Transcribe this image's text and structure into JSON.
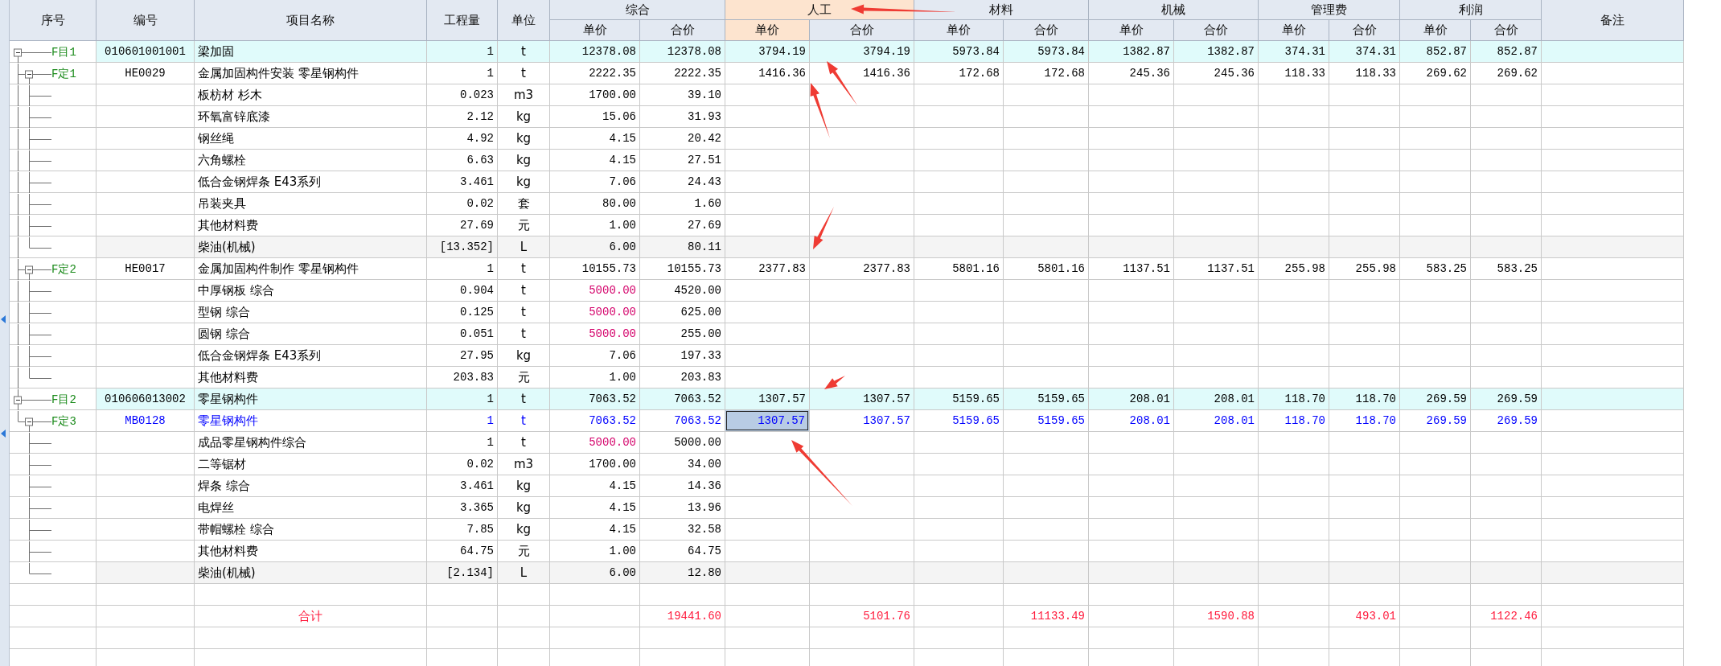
{
  "table": {
    "columns": [
      {
        "label": "序号"
      },
      {
        "label": "编号"
      },
      {
        "label": "项目名称"
      },
      {
        "label": "工程量"
      },
      {
        "label": "单位"
      },
      {
        "label": "综合",
        "subcolumns": [
          {
            "label": "单价",
            "selected": false
          },
          {
            "label": "合价",
            "selected": false
          }
        ]
      },
      {
        "label": "人工",
        "subcolumns": [
          {
            "label": "单价",
            "selected": true
          },
          {
            "label": "合价",
            "selected": false
          }
        ]
      },
      {
        "label": "材料",
        "subcolumns": [
          {
            "label": "单价",
            "selected": false
          },
          {
            "label": "合价",
            "selected": false
          }
        ]
      },
      {
        "label": "机械",
        "subcolumns": [
          {
            "label": "单价",
            "selected": false
          },
          {
            "label": "合价",
            "selected": false
          }
        ]
      },
      {
        "label": "管理费",
        "subcolumns": [
          {
            "label": "单价",
            "selected": false
          },
          {
            "label": "合价",
            "selected": false
          }
        ]
      },
      {
        "label": "利润",
        "subcolumns": [
          {
            "label": "单价",
            "selected": false
          },
          {
            "label": "合价",
            "selected": false
          }
        ]
      },
      {
        "label": "备注"
      }
    ],
    "rows": [
      {
        "kind": "bill",
        "seq": "F目1",
        "code": "010601001001",
        "name": "梁加固",
        "quantity": "1",
        "unit": "t",
        "expanded": true,
        "selected": false,
        "modified": false,
        "prices": [
          "12378.08",
          "12378.08",
          "3794.19",
          "3794.19",
          "5973.84",
          "5973.84",
          "1382.87",
          "1382.87",
          "374.31",
          "374.31",
          "852.87",
          "852.87"
        ],
        "children": [
          {
            "kind": "quota",
            "seq": "F定1",
            "code": "HE0029",
            "name": "金属加固构件安装 零星钢构件",
            "quantity": "1",
            "unit": "t",
            "expanded": true,
            "selected": false,
            "modified": false,
            "prices": [
              "2222.35",
              "2222.35",
              "1416.36",
              "1416.36",
              "172.68",
              "172.68",
              "245.36",
              "245.36",
              "118.33",
              "118.33",
              "269.62",
              "269.62"
            ],
            "children": [
              {
                "kind": "material",
                "name": "板枋材 杉木",
                "quantity": "0.023",
                "unit": "m3",
                "price_adjusted": false,
                "prices": [
                  "1700.00",
                  "39.10"
                ]
              },
              {
                "kind": "material",
                "name": "环氧富锌底漆",
                "quantity": "2.12",
                "unit": "kg",
                "price_adjusted": false,
                "prices": [
                  "15.06",
                  "31.93"
                ]
              },
              {
                "kind": "material",
                "name": "钢丝绳",
                "quantity": "4.92",
                "unit": "kg",
                "price_adjusted": false,
                "prices": [
                  "4.15",
                  "20.42"
                ]
              },
              {
                "kind": "material",
                "name": "六角螺栓",
                "quantity": "6.63",
                "unit": "kg",
                "price_adjusted": false,
                "prices": [
                  "4.15",
                  "27.51"
                ]
              },
              {
                "kind": "material",
                "name": "低合金钢焊条 E43系列",
                "quantity": "3.461",
                "unit": "kg",
                "price_adjusted": false,
                "prices": [
                  "7.06",
                  "24.43"
                ]
              },
              {
                "kind": "material",
                "name": "吊装夹具",
                "quantity": "0.02",
                "unit": "套",
                "price_adjusted": false,
                "prices": [
                  "80.00",
                  "1.60"
                ]
              },
              {
                "kind": "material",
                "name": "其他材料费",
                "quantity": "27.69",
                "unit": "元",
                "price_adjusted": false,
                "prices": [
                  "1.00",
                  "27.69"
                ]
              },
              {
                "kind": "machine_material",
                "name": "柴油(机械)",
                "quantity": "[13.352]",
                "unit": "L",
                "price_adjusted": false,
                "prices": [
                  "6.00",
                  "80.11"
                ]
              }
            ]
          },
          {
            "kind": "quota",
            "seq": "F定2",
            "code": "HE0017",
            "name": "金属加固构件制作 零星钢构件",
            "quantity": "1",
            "unit": "t",
            "expanded": true,
            "selected": false,
            "modified": false,
            "prices": [
              "10155.73",
              "10155.73",
              "2377.83",
              "2377.83",
              "5801.16",
              "5801.16",
              "1137.51",
              "1137.51",
              "255.98",
              "255.98",
              "583.25",
              "583.25"
            ],
            "children": [
              {
                "kind": "material",
                "name": "中厚钢板 综合",
                "quantity": "0.904",
                "unit": "t",
                "price_adjusted": true,
                "prices": [
                  "5000.00",
                  "4520.00"
                ]
              },
              {
                "kind": "material",
                "name": "型钢 综合",
                "quantity": "0.125",
                "unit": "t",
                "price_adjusted": true,
                "prices": [
                  "5000.00",
                  "625.00"
                ]
              },
              {
                "kind": "material",
                "name": "圆钢 综合",
                "quantity": "0.051",
                "unit": "t",
                "price_adjusted": true,
                "prices": [
                  "5000.00",
                  "255.00"
                ]
              },
              {
                "kind": "material",
                "name": "低合金钢焊条 E43系列",
                "quantity": "27.95",
                "unit": "kg",
                "price_adjusted": false,
                "prices": [
                  "7.06",
                  "197.33"
                ]
              },
              {
                "kind": "material",
                "name": "其他材料费",
                "quantity": "203.83",
                "unit": "元",
                "price_adjusted": false,
                "prices": [
                  "1.00",
                  "203.83"
                ]
              }
            ]
          }
        ]
      },
      {
        "kind": "bill",
        "seq": "F目2",
        "code": "010606013002",
        "name": "零星钢构件",
        "quantity": "1",
        "unit": "t",
        "expanded": true,
        "selected": false,
        "modified": false,
        "prices": [
          "7063.52",
          "7063.52",
          "1307.57",
          "1307.57",
          "5159.65",
          "5159.65",
          "208.01",
          "208.01",
          "118.70",
          "118.70",
          "269.59",
          "269.59"
        ],
        "children": [
          {
            "kind": "quota",
            "seq": "F定3",
            "code": "MB0128",
            "name": "零星钢构件",
            "quantity": "1",
            "unit": "t",
            "expanded": true,
            "selected": true,
            "modified": true,
            "prices": [
              "7063.52",
              "7063.52",
              "1307.57",
              "1307.57",
              "5159.65",
              "5159.65",
              "208.01",
              "208.01",
              "118.70",
              "118.70",
              "269.59",
              "269.59"
            ],
            "children": [
              {
                "kind": "material",
                "name": "成品零星钢构件综合",
                "quantity": "1",
                "unit": "t",
                "price_adjusted": true,
                "prices": [
                  "5000.00",
                  "5000.00"
                ]
              },
              {
                "kind": "material",
                "name": "二等锯材",
                "quantity": "0.02",
                "unit": "m3",
                "price_adjusted": false,
                "prices": [
                  "1700.00",
                  "34.00"
                ]
              },
              {
                "kind": "material",
                "name": "焊条 综合",
                "quantity": "3.461",
                "unit": "kg",
                "price_adjusted": false,
                "prices": [
                  "4.15",
                  "14.36"
                ]
              },
              {
                "kind": "material",
                "name": "电焊丝",
                "quantity": "3.365",
                "unit": "kg",
                "price_adjusted": false,
                "prices": [
                  "4.15",
                  "13.96"
                ]
              },
              {
                "kind": "material",
                "name": "带帽螺栓 综合",
                "quantity": "7.85",
                "unit": "kg",
                "price_adjusted": false,
                "prices": [
                  "4.15",
                  "32.58"
                ]
              },
              {
                "kind": "material",
                "name": "其他材料费",
                "quantity": "64.75",
                "unit": "元",
                "price_adjusted": false,
                "prices": [
                  "1.00",
                  "64.75"
                ]
              },
              {
                "kind": "machine_material",
                "name": "柴油(机械)",
                "quantity": "[2.134]",
                "unit": "L",
                "price_adjusted": false,
                "prices": [
                  "6.00",
                  "12.80"
                ]
              }
            ]
          }
        ]
      }
    ],
    "total": {
      "label": "合计",
      "sums": [
        "19441.60",
        "5101.76",
        "11133.49",
        "1590.88",
        "493.01",
        "1122.46"
      ]
    }
  }
}
